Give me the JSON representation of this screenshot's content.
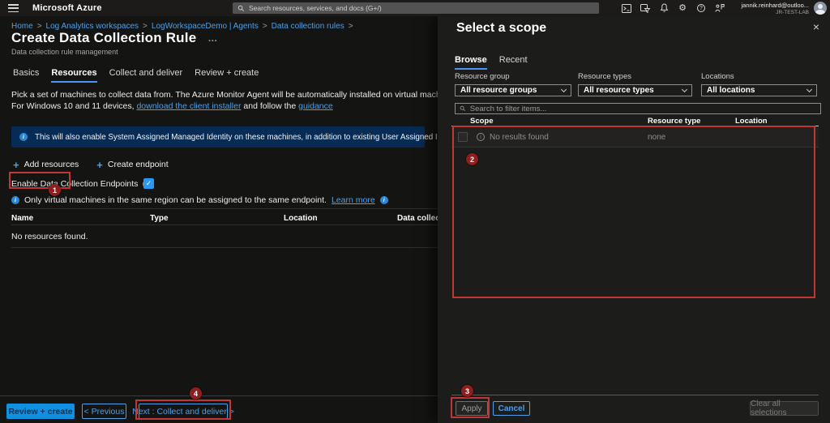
{
  "topbar": {
    "brand": "Microsoft Azure",
    "search_placeholder": "Search resources, services, and docs (G+/)",
    "user": {
      "email": "jannik.reinhard@outloo...",
      "tenant": "JR-TEST-LAB"
    }
  },
  "breadcrumb": {
    "separator": ">",
    "items": [
      "Home",
      "Log Analytics workspaces",
      "LogWorkspaceDemo | Agents",
      "Data collection rules"
    ]
  },
  "icons": {
    "plus": "+",
    "close": "×",
    "more": "…",
    "check": "✓",
    "info": "i",
    "question": "?",
    "gear": "⚙"
  },
  "page": {
    "title": "Create Data Collection Rule",
    "subtitle": "Data collection rule management",
    "tabs": [
      {
        "label": "Basics",
        "active": false
      },
      {
        "label": "Resources",
        "active": true
      },
      {
        "label": "Collect and deliver",
        "active": false
      },
      {
        "label": "Review + create",
        "active": false
      }
    ],
    "intro_line1": "Pick a set of machines to collect data from. The Azure Monitor Agent will be automatically installed on virtual machines, scale sets, and Arc-enabled servers.",
    "intro_line2_prefix": "For Windows 10 and 11 devices, ",
    "intro_link1": "download the client installer",
    "intro_line2_mid": " and follow the ",
    "intro_link2": "guidance",
    "info_banner": "This will also enable System Assigned Managed Identity on these machines, in addition to existing User Assigned Identities (if any).",
    "add_resources_label": "Add resources",
    "create_endpoint_label": "Create endpoint",
    "enable_dce_label": "Enable Data Collection Endpoints",
    "region_note": "Only virtual machines in the same region can be assigned to the same endpoint.",
    "learn_more": "Learn more",
    "table": {
      "columns": [
        "Name",
        "Type",
        "Location",
        "Data collection endpoint"
      ],
      "empty": "No resources found."
    },
    "footer": {
      "review_create": "Review + create",
      "previous": "< Previous",
      "next": "Next : Collect and deliver >"
    }
  },
  "panel": {
    "title": "Select a scope",
    "tabs": [
      {
        "label": "Browse",
        "active": true
      },
      {
        "label": "Recent",
        "active": false
      }
    ],
    "filters": [
      {
        "label": "Resource group",
        "value": "All resource groups"
      },
      {
        "label": "Resource types",
        "value": "All resource types"
      },
      {
        "label": "Locations",
        "value": "All locations"
      }
    ],
    "search_placeholder": "Search to filter items...",
    "table": {
      "columns": [
        "Scope",
        "Resource type",
        "Location"
      ],
      "empty": "No results found",
      "empty_type": "none"
    },
    "footer": {
      "apply": "Apply",
      "cancel": "Cancel",
      "clear": "Clear all selections"
    }
  },
  "annotations": {
    "steps": [
      "1",
      "2",
      "3",
      "4"
    ]
  },
  "colors": {
    "accent_blue": "#4ba0e8",
    "primary_button": "#1090e0",
    "checkbox_blue": "#2899f5",
    "info_banner_bg": "#062b55",
    "annotation_box": "#c43636",
    "annotation_badge": "#8e1f1f",
    "topbar_bg": "#1c1b1a",
    "page_bg": "#141413",
    "panel_bg": "#1c1c1b"
  }
}
